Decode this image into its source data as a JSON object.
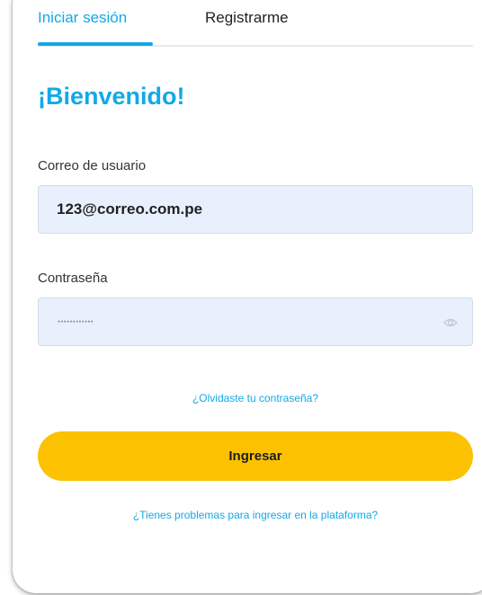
{
  "tabs": {
    "login": "Iniciar sesión",
    "register": "Registrarme"
  },
  "title": "¡Bienvenido!",
  "email": {
    "label": "Correo de usuario",
    "value": "123@correo.com.pe"
  },
  "password": {
    "label": "Contraseña",
    "value": "············",
    "toggle_icon": "eye-icon"
  },
  "forgot_password": "¿Olvidaste tu contraseña?",
  "submit": "Ingresar",
  "help_link": "¿Tienes problemas para ingresar en la plataforma?",
  "colors": {
    "accent": "#12a9e6",
    "button": "#fcc201",
    "field_bg": "#e8f0fe"
  }
}
